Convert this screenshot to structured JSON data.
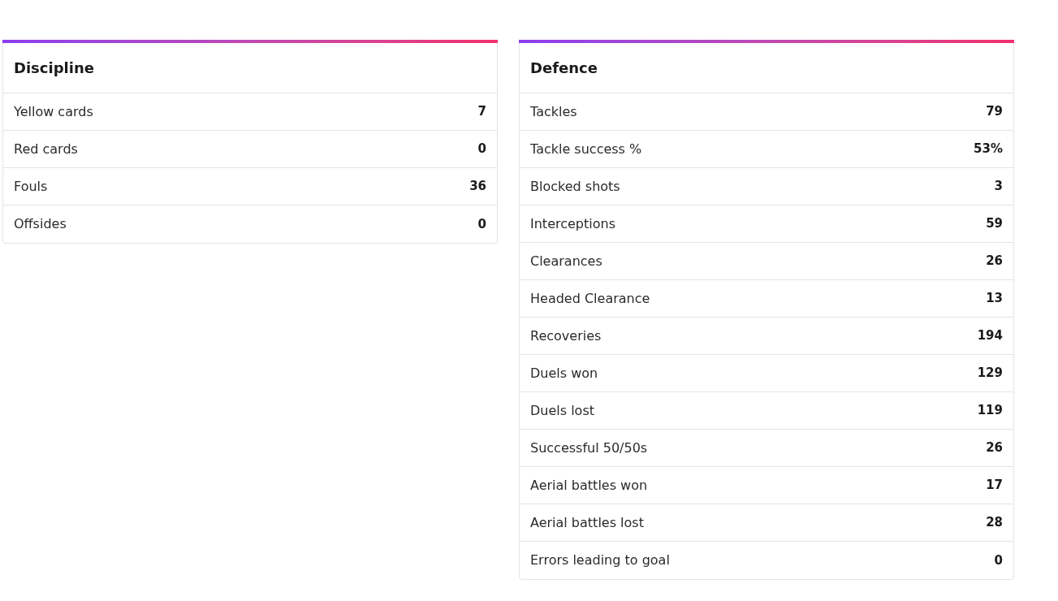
{
  "cards": [
    {
      "title": "Discipline",
      "rows": [
        {
          "label": "Yellow cards",
          "value": "7"
        },
        {
          "label": "Red cards",
          "value": "0"
        },
        {
          "label": "Fouls",
          "value": "36"
        },
        {
          "label": "Offsides",
          "value": "0"
        }
      ]
    },
    {
      "title": "Defence",
      "rows": [
        {
          "label": "Tackles",
          "value": "79"
        },
        {
          "label": "Tackle success %",
          "value": "53%"
        },
        {
          "label": "Blocked shots",
          "value": "3"
        },
        {
          "label": "Interceptions",
          "value": "59"
        },
        {
          "label": "Clearances",
          "value": "26"
        },
        {
          "label": "Headed Clearance",
          "value": "13"
        },
        {
          "label": "Recoveries",
          "value": "194"
        },
        {
          "label": "Duels won",
          "value": "129"
        },
        {
          "label": "Duels lost",
          "value": "119"
        },
        {
          "label": "Successful 50/50s",
          "value": "26"
        },
        {
          "label": "Aerial battles won",
          "value": "17"
        },
        {
          "label": "Aerial battles lost",
          "value": "28"
        },
        {
          "label": "Errors leading to goal",
          "value": "0"
        }
      ]
    }
  ]
}
